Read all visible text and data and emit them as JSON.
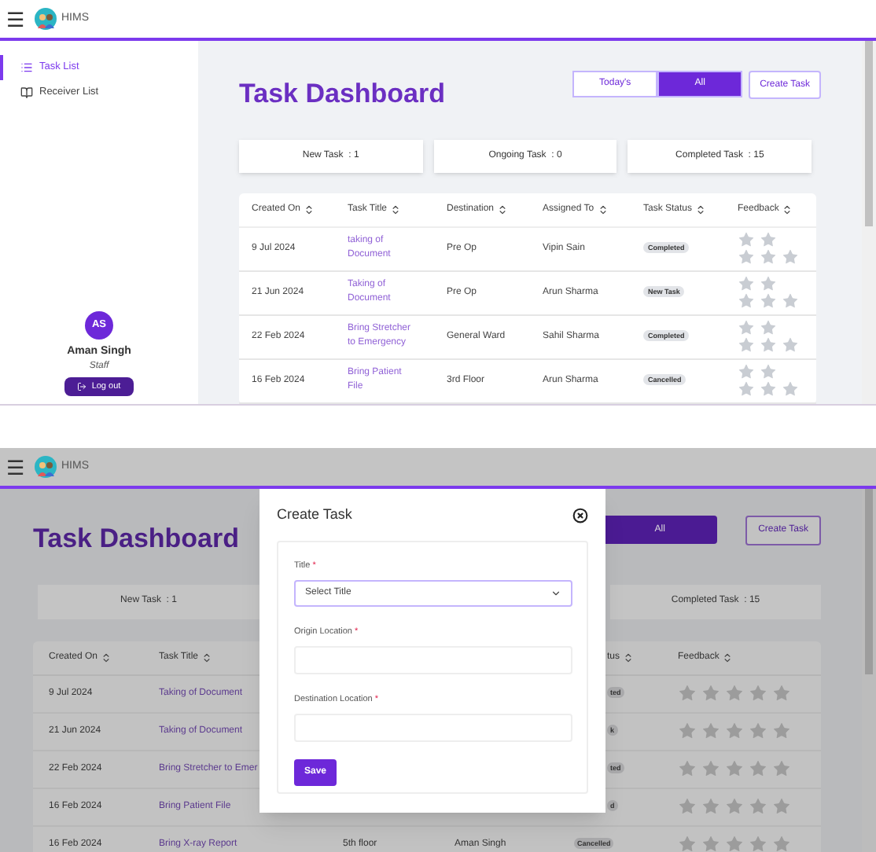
{
  "top": {
    "header": {
      "menu": "☰",
      "app_name": "HIMS"
    },
    "sidebar": {
      "items": [
        {
          "label": "Task List",
          "selected": true
        },
        {
          "label": "Receiver List",
          "selected": false
        }
      ],
      "user": {
        "initials": "AS",
        "name": "Aman Singh",
        "role": "Staff"
      },
      "logout": "Log out"
    },
    "title": "Task Dashboard",
    "filters": [
      {
        "label": "Today's",
        "selected": false
      },
      {
        "label": "All",
        "selected": true
      }
    ],
    "create_button": "Create Task",
    "counters": [
      {
        "label": "New Task  : 1"
      },
      {
        "label": "Ongoing Task  : 0"
      },
      {
        "label": "Completed Task  : 15"
      }
    ],
    "table": {
      "columns": [
        "Created On",
        "Task Title",
        "Destination",
        "Assigned To",
        "Task Status",
        "Feedback"
      ],
      "rows": [
        {
          "created_on": "9 Jul 2024",
          "title": "taking of Document",
          "destination": "Pre Op",
          "assigned_to": "Vipin Sain",
          "status": "Completed",
          "stars": 0
        },
        {
          "created_on": "21 Jun 2024",
          "title": "Taking of Document",
          "destination": "Pre Op",
          "assigned_to": "Arun Sharma",
          "status": "New Task",
          "stars": 0
        },
        {
          "created_on": "22 Feb 2024",
          "title": "Bring Stretcher to Emergency",
          "destination": "General Ward",
          "assigned_to": "Sahil Sharma",
          "status": "Completed",
          "stars": 0
        },
        {
          "created_on": "16 Feb 2024",
          "title": "Bring Patient File",
          "destination": "3rd Floor",
          "assigned_to": "Arun Sharma",
          "status": "Cancelled",
          "stars": 0
        }
      ]
    }
  },
  "bottom": {
    "header": {
      "menu": "☰",
      "app_name": "HIMS"
    },
    "title": "Task Dashboard",
    "filters": [
      {
        "label": "All",
        "selected": true
      }
    ],
    "create_button": "Create Task",
    "counters": [
      {
        "label": "New Task  : 1"
      },
      {
        "label": "Completed Task  : 15"
      }
    ],
    "table": {
      "columns": [
        "Created On",
        "Task Title",
        "tus",
        "Feedback"
      ],
      "rows": [
        {
          "created_on": "9 Jul 2024",
          "title": "Taking of Document",
          "status": "ted",
          "stars": 0
        },
        {
          "created_on": "21 Jun 2024",
          "title": "Taking of Document",
          "status": "k",
          "stars": 0
        },
        {
          "created_on": "22 Feb 2024",
          "title": "Bring Stretcher to Emer",
          "status": "ted",
          "stars": 0
        },
        {
          "created_on": "16 Feb 2024",
          "title": "Bring Patient File",
          "status": "d",
          "stars": 0
        },
        {
          "created_on": "16 Feb 2024",
          "title": "Bring X-ray Report",
          "destination": "5th floor",
          "assigned_to": "Aman Singh",
          "status": "Cancelled",
          "stars": 0
        }
      ]
    },
    "modal": {
      "title": "Create Task",
      "fields": [
        {
          "kind": "select",
          "label": "Title",
          "required_mark": "*",
          "placeholder": "Select Title"
        },
        {
          "kind": "text",
          "label": "Origin Location",
          "required_mark": "*"
        },
        {
          "kind": "text",
          "label": "Destination Location",
          "required_mark": "*"
        }
      ],
      "save": "Save"
    }
  }
}
